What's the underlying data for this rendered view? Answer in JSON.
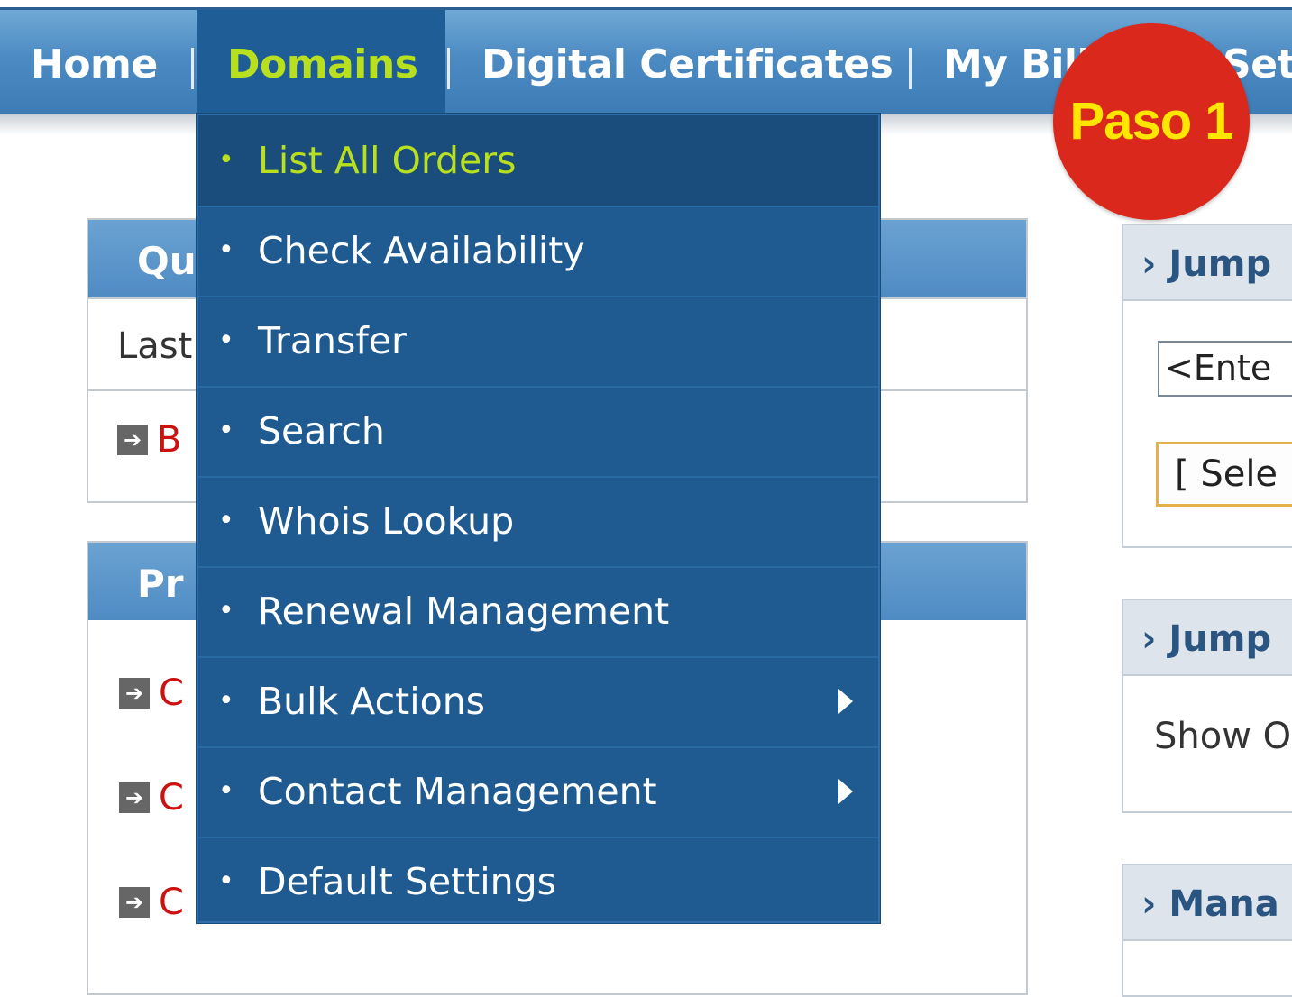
{
  "nav": {
    "items": [
      {
        "label": "Home"
      },
      {
        "label": "Domains"
      },
      {
        "label": "Digital Certificates"
      },
      {
        "label": "My Bill"
      },
      {
        "label": "Set"
      }
    ],
    "active_index": 1
  },
  "left_panels": {
    "quick": {
      "header": "Qu",
      "row1": "Last",
      "row2_link": "B"
    },
    "products": {
      "header": "Pr",
      "rows": [
        "C",
        "C",
        "C"
      ]
    }
  },
  "right_panels": {
    "jump1": {
      "header": "Jump",
      "input_value": "<Ente",
      "select_value": "[ Sele"
    },
    "jump2": {
      "header": "Jump",
      "text": "Show O"
    },
    "manage": {
      "header": "Mana"
    }
  },
  "menu": {
    "items": [
      {
        "label": "List All Orders",
        "highlighted": true,
        "submenu": false
      },
      {
        "label": "Check Availability",
        "submenu": false
      },
      {
        "label": "Transfer",
        "submenu": false
      },
      {
        "label": "Search",
        "submenu": false
      },
      {
        "label": "Whois Lookup",
        "submenu": false
      },
      {
        "label": "Renewal Management",
        "submenu": false
      },
      {
        "label": "Bulk Actions",
        "submenu": true
      },
      {
        "label": "Contact Management",
        "submenu": true
      },
      {
        "label": "Default Settings",
        "submenu": false
      }
    ]
  },
  "badge": {
    "label": "Paso 1",
    "bg_color": "#da291c",
    "text_color": "#ffe600"
  },
  "colors": {
    "nav_bg": "#4b8ac2",
    "menu_bg": "#1f5b91",
    "active_text": "#b8e01e",
    "link_red": "#cc1111"
  }
}
